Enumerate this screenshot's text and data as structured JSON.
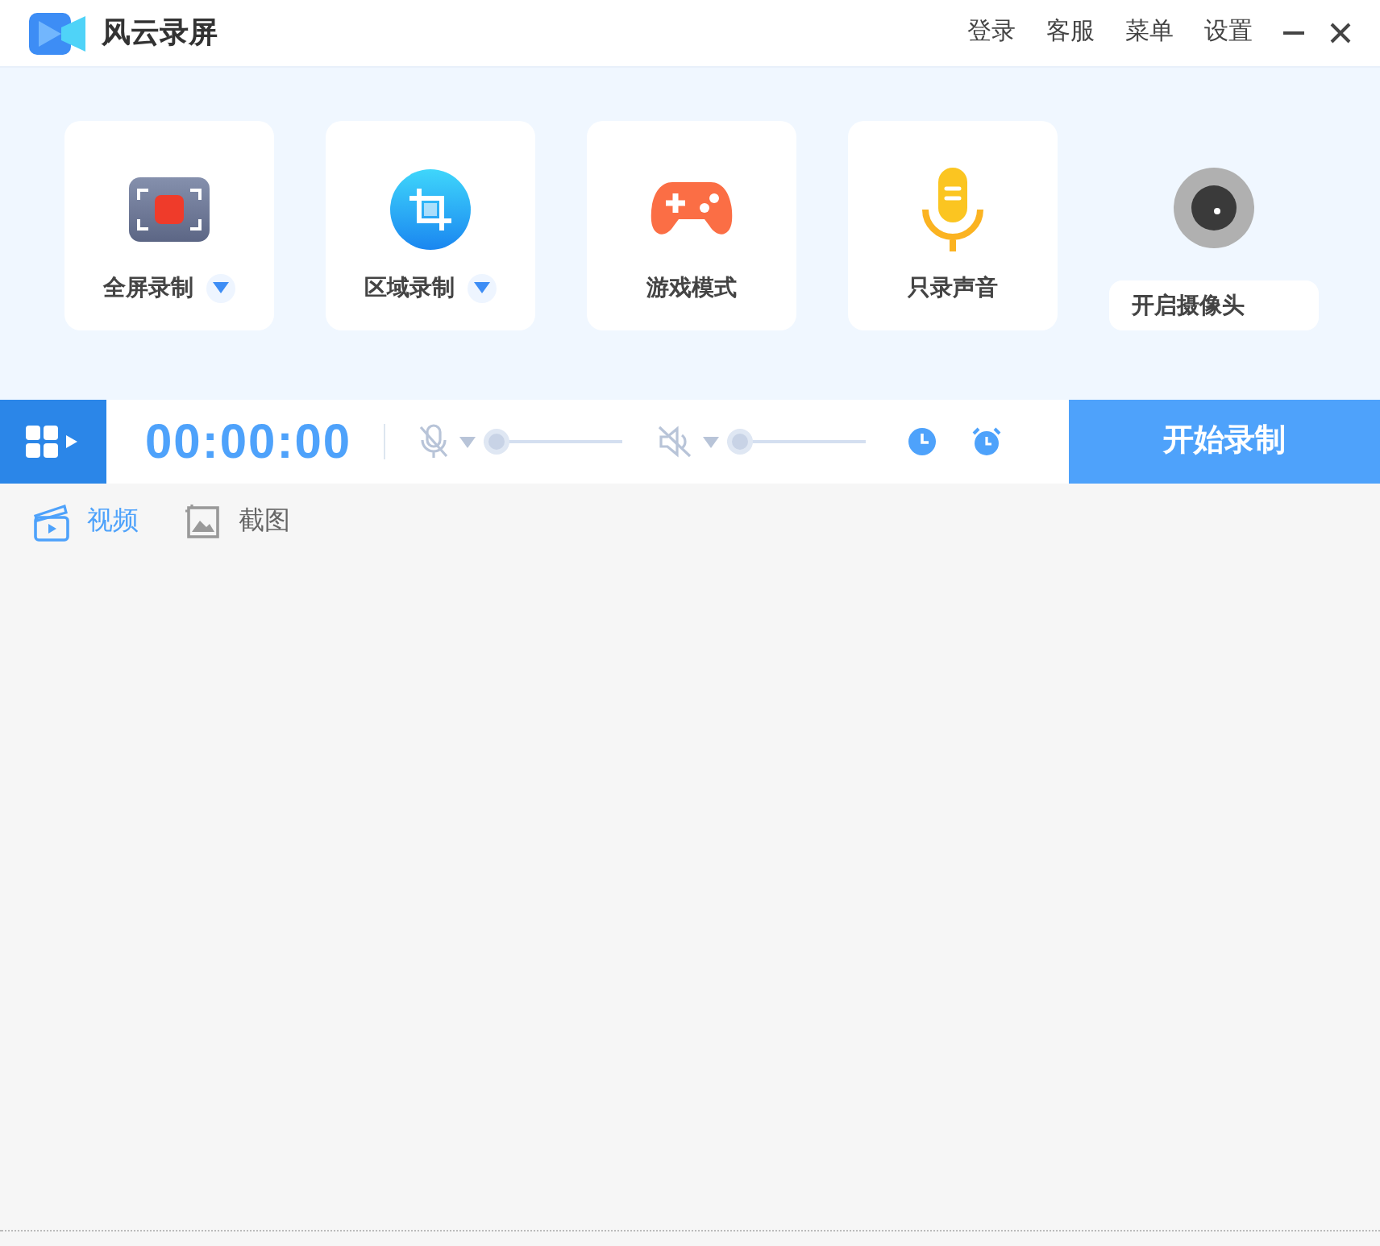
{
  "window": {
    "title": "风云录屏",
    "menu": [
      "登录",
      "客服",
      "菜单",
      "设置"
    ]
  },
  "modes": [
    {
      "label": "全屏录制",
      "kind": "fullscreen",
      "dropdown": true
    },
    {
      "label": "区域录制",
      "kind": "region",
      "dropdown": true
    },
    {
      "label": "游戏模式",
      "kind": "game",
      "dropdown": false
    },
    {
      "label": "只录声音",
      "kind": "audio",
      "dropdown": false
    }
  ],
  "camera": {
    "label": "开启摄像头"
  },
  "toolbar": {
    "timer": "00:00:00",
    "mic": {
      "level": 0
    },
    "speaker": {
      "level": 0
    },
    "record_button": "开始录制"
  },
  "tabs": [
    {
      "label": "视频",
      "selected": true
    },
    {
      "label": "截图",
      "selected": false
    }
  ]
}
